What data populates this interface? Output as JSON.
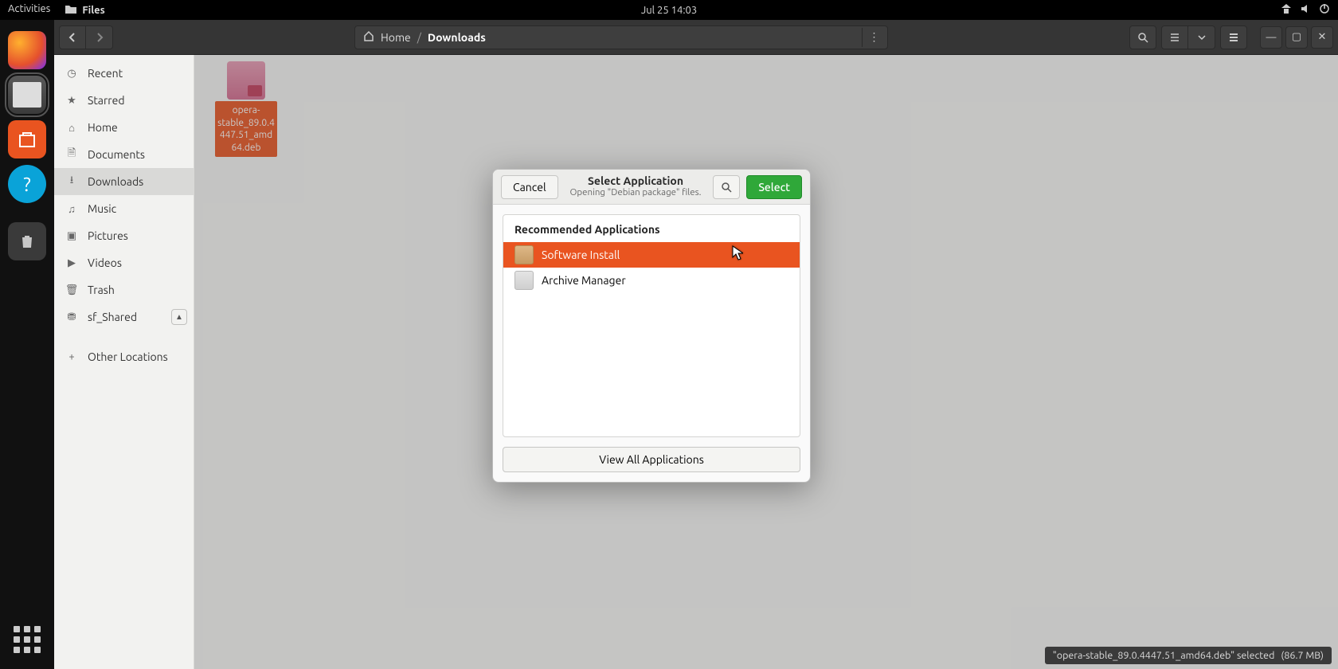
{
  "panel": {
    "activities": "Activities",
    "app_label": "Files",
    "datetime": "Jul 25  14:03"
  },
  "pathbar": {
    "home": "Home",
    "current": "Downloads"
  },
  "sidebar": {
    "items": [
      {
        "label": "Recent"
      },
      {
        "label": "Starred"
      },
      {
        "label": "Home"
      },
      {
        "label": "Documents"
      },
      {
        "label": "Downloads"
      },
      {
        "label": "Music"
      },
      {
        "label": "Pictures"
      },
      {
        "label": "Videos"
      },
      {
        "label": "Trash"
      },
      {
        "label": "sf_Shared"
      },
      {
        "label": "Other Locations"
      }
    ]
  },
  "file": {
    "name": "opera-stable_89.0.4447.51_amd64.deb"
  },
  "dialog": {
    "cancel": "Cancel",
    "select": "Select",
    "title": "Select Application",
    "subtitle": "Opening \"Debian package\" files.",
    "section": "Recommended Applications",
    "apps": [
      {
        "label": "Software Install"
      },
      {
        "label": "Archive Manager"
      }
    ],
    "view_all": "View All Applications"
  },
  "status": {
    "text": "\"opera-stable_89.0.4447.51_amd64.deb\" selected",
    "size": "(86.7 MB)"
  }
}
